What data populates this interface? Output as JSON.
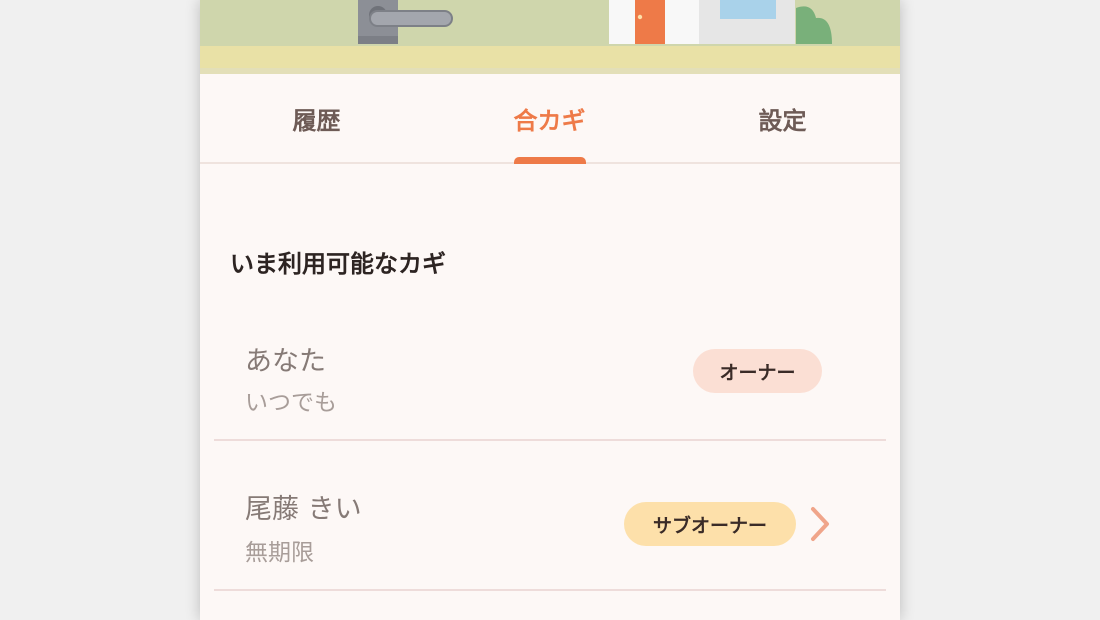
{
  "tabs": [
    {
      "label": "履歴",
      "active": false
    },
    {
      "label": "合カギ",
      "active": true
    },
    {
      "label": "設定",
      "active": false
    }
  ],
  "section_title": "いま利用可能なカギ",
  "keys": [
    {
      "name": "あなた",
      "period": "いつでも",
      "role": "オーナー"
    },
    {
      "name": "尾藤 きい",
      "period": "無期限",
      "role": "サブオーナー"
    }
  ],
  "colors": {
    "accent": "#ee7a48",
    "owner_badge": "#fbdfd4",
    "subowner_badge": "#fde0aa"
  },
  "icons": {
    "hero": "door-handle-and-house-illustration",
    "row_chevron": "chevron-right-icon"
  }
}
